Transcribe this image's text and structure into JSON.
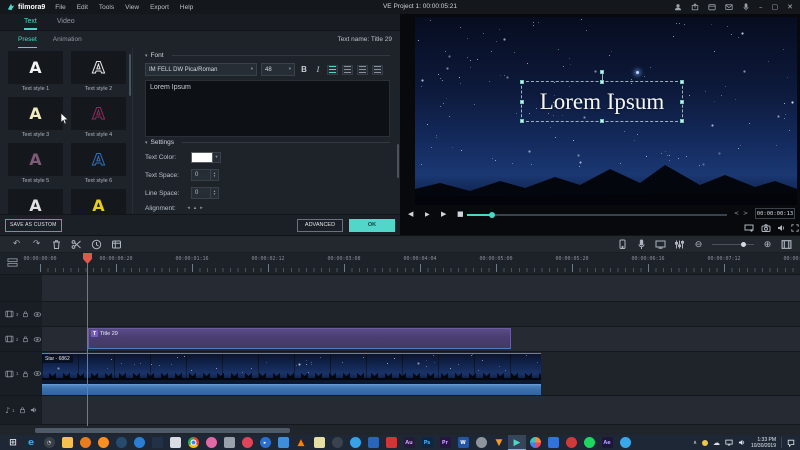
{
  "titlebar": {
    "app_name": "filmora9",
    "menus": [
      "File",
      "Edit",
      "Tools",
      "View",
      "Export",
      "Help"
    ],
    "project_title": "VE Project 1: 00:00:05:21"
  },
  "left_panel": {
    "tabs": [
      {
        "label": "Text",
        "active": true
      },
      {
        "label": "Video",
        "active": false
      }
    ],
    "subtabs": [
      {
        "label": "Preset",
        "active": true
      },
      {
        "label": "Animation",
        "active": false
      }
    ],
    "text_name": "Text name: Title 29",
    "styles": [
      {
        "label": "Text style 1",
        "letter": "A",
        "color": "#f2f2f2",
        "style": "solid"
      },
      {
        "label": "Text style 2",
        "letter": "A",
        "color": "#e8e8e8",
        "style": "outline"
      },
      {
        "label": "Text style 3",
        "letter": "A",
        "color": "#efe9c0",
        "style": "solid"
      },
      {
        "label": "Text style 4",
        "letter": "A",
        "color": "#93295c",
        "style": "outline"
      },
      {
        "label": "Text style 5",
        "letter": "A",
        "color": "#7d5a78",
        "style": "solid"
      },
      {
        "label": "Text style 6",
        "letter": "A",
        "color": "#2f6fc0",
        "style": "outline"
      },
      {
        "label": "",
        "letter": "A",
        "color": "#e0e0e0",
        "style": "solid"
      },
      {
        "label": "",
        "letter": "A",
        "color": "#e8cc1e",
        "style": "solid"
      }
    ],
    "save_as_custom_label": "SAVE AS CUSTOM",
    "advanced_label": "ADVANCED",
    "ok_label": "OK"
  },
  "font_panel": {
    "font_section_label": "Font",
    "font_family_value": "IM FELL DW Pica/Roman",
    "font_size_value": "48",
    "bold_label": "B",
    "italic_label": "I",
    "text_input_value": "Lorem Ipsum",
    "settings_section_label": "Settings",
    "text_color_label": "Text Color:",
    "text_color_value": "#ffffff",
    "text_space_label": "Text Space:",
    "text_space_value": "0",
    "line_space_label": "Line Space:",
    "line_space_value": "0",
    "alignment_label": "Alignment:"
  },
  "preview": {
    "overlay_text": "Lorem Ipsum",
    "current_timecode": "00:00:00:13"
  },
  "timeline": {
    "ruler_ticks": [
      "00:00:00:00",
      "00:00:00:20",
      "00:00:01:16",
      "00:00:02:12",
      "00:00:03:08",
      "00:00:04:04",
      "00:00:05:00",
      "00:00:05:20",
      "00:00:06:16",
      "00:00:07:12",
      "00:00:08:08"
    ],
    "tracks": [
      {
        "num": "3",
        "kind": "video"
      },
      {
        "num": "2",
        "kind": "video",
        "clip_label": "Title 29"
      },
      {
        "num": "1",
        "kind": "video",
        "clip_label": "Star - 6862"
      },
      {
        "num": "1",
        "kind": "audio"
      }
    ]
  },
  "taskbar": {
    "icons": [
      {
        "name": "start",
        "glyph": "⊞",
        "fg": "#dfe3e8",
        "shape": "none",
        "big": true
      },
      {
        "name": "edge",
        "glyph": "e",
        "fg": "#3fa2e8",
        "shape": "none",
        "big": true
      },
      {
        "name": "media-clock-app",
        "shape": "ci",
        "bg": "#3a4048",
        "glyph": "◔",
        "fg": "#c9ced5"
      },
      {
        "name": "file-explorer",
        "shape": "sq",
        "bg": "#f2c14e"
      },
      {
        "name": "orange-app",
        "shape": "ci",
        "bg": "#e87c1e"
      },
      {
        "name": "firefox",
        "shape": "ci",
        "bg": "#ff8f1f"
      },
      {
        "name": "steam",
        "shape": "ci",
        "bg": "#274b6d"
      },
      {
        "name": "blue-dial-app",
        "shape": "ci",
        "bg": "#2a7fd4"
      },
      {
        "name": "dark-blue-app",
        "shape": "sq",
        "bg": "#223148"
      },
      {
        "name": "calculator",
        "shape": "sq",
        "bg": "#d7dde3"
      },
      {
        "name": "chrome",
        "shape": "ci",
        "cls": "chrome"
      },
      {
        "name": "pink-app",
        "shape": "ci",
        "bg": "#e06aa6"
      },
      {
        "name": "gray-app",
        "shape": "sq",
        "bg": "#99a1ab"
      },
      {
        "name": "red-app",
        "shape": "ci",
        "bg": "#e04458"
      },
      {
        "name": "media-player",
        "shape": "ci",
        "bg": "#2a6fd0",
        "glyph": "▸",
        "fg": "#ffffff"
      },
      {
        "name": "monitor-app",
        "shape": "sq",
        "bg": "#3f8edb"
      },
      {
        "name": "vlc",
        "glyph": "▲",
        "fg": "#ff7f00",
        "shape": "none",
        "big": true
      },
      {
        "name": "notes-app",
        "shape": "sq",
        "bg": "#e6dfa3"
      },
      {
        "name": "dark-app",
        "shape": "ci",
        "bg": "#3a424d"
      },
      {
        "name": "blue-sphere-app",
        "shape": "ci",
        "bg": "#36a3e8"
      },
      {
        "name": "blue-square-app",
        "shape": "sq",
        "bg": "#2a66b8"
      },
      {
        "name": "red-square-app",
        "shape": "sq",
        "bg": "#d23535"
      },
      {
        "name": "audition",
        "shape": "sq",
        "bg": "#241b38",
        "glyph": "Au",
        "fg": "#c79bff"
      },
      {
        "name": "photoshop",
        "shape": "sq",
        "bg": "#0d2740",
        "glyph": "Ps",
        "fg": "#45b0ff"
      },
      {
        "name": "premiere",
        "shape": "sq",
        "bg": "#25153f",
        "glyph": "Pr",
        "fg": "#c99bff"
      },
      {
        "name": "word",
        "shape": "sq",
        "bg": "#2455a4",
        "glyph": "W",
        "fg": "#ffffff"
      },
      {
        "name": "gray-round-app",
        "shape": "ci",
        "bg": "#8d949c"
      },
      {
        "name": "downloader",
        "glyph": "▼",
        "fg": "#f59a23",
        "shape": "none",
        "big": true
      },
      {
        "name": "filmora",
        "glyph": "▶",
        "fg": "#4bd6c8",
        "shape": "none",
        "big": true,
        "active": true
      },
      {
        "name": "resolve",
        "shape": "ci",
        "cls": "resolve"
      },
      {
        "name": "vs-app",
        "shape": "sq",
        "bg": "#3273d8"
      },
      {
        "name": "red-round-app",
        "shape": "ci",
        "bg": "#cf3a3a"
      },
      {
        "name": "spotify",
        "shape": "ci",
        "bg": "#1ed760"
      },
      {
        "name": "after-effects",
        "shape": "sq",
        "bg": "#1c1638",
        "glyph": "Ae",
        "fg": "#a79bff"
      },
      {
        "name": "blue-bird-app",
        "shape": "ci",
        "bg": "#38a8e8"
      }
    ],
    "tray_time": "1:33 PM",
    "tray_date": "10/30/2019"
  },
  "colors": {
    "accent": "#4bd6c8",
    "playhead": "#e0584a",
    "title_clip": "#4a3d70",
    "video_clip_audio": "#3b70ad"
  }
}
